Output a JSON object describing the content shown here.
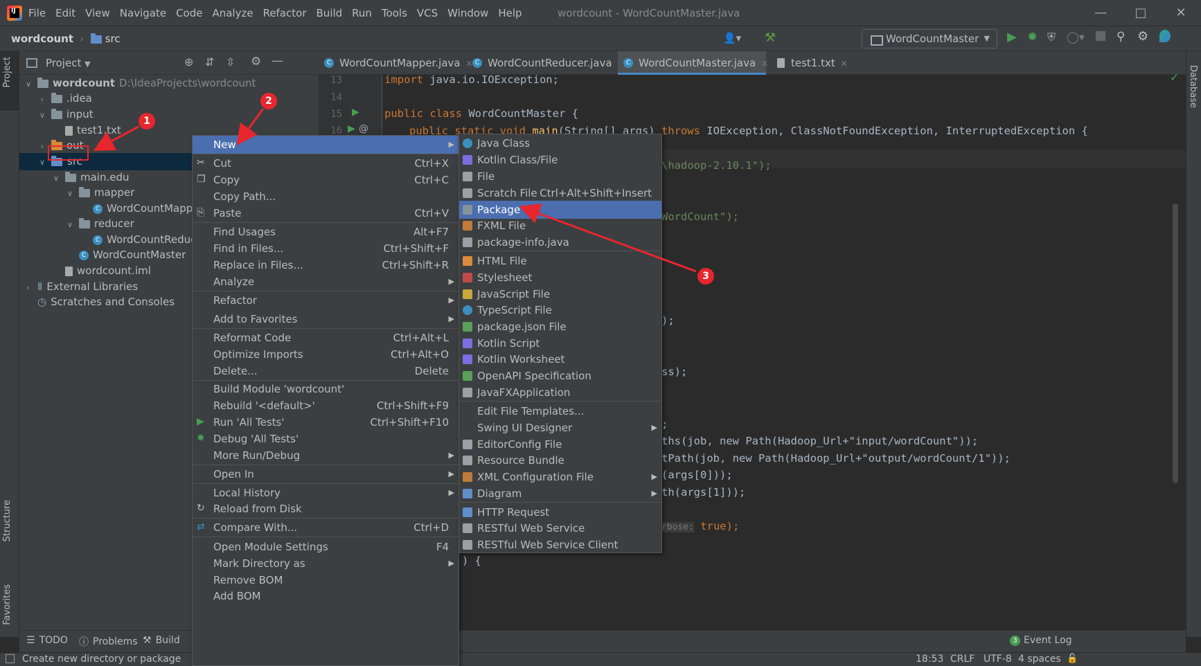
{
  "menubar": {
    "items": [
      "File",
      "Edit",
      "View",
      "Navigate",
      "Code",
      "Analyze",
      "Refactor",
      "Build",
      "Run",
      "Tools",
      "VCS",
      "Window",
      "Help"
    ],
    "title": "wordcount - WordCountMaster.java"
  },
  "navbar": {
    "project": "wordcount",
    "folder": "src",
    "run_config": "WordCountMaster"
  },
  "left_stripe": {
    "project_tab": "Project",
    "structure_tab": "Structure",
    "favorites_tab": "Favorites"
  },
  "right_stripe": {
    "database_tab": "Database"
  },
  "project_panel": {
    "title": "Project",
    "tree": [
      {
        "label": "wordcount",
        "extra": "D:\\IdeaProjects\\wordcount",
        "depth": 0,
        "open": true,
        "icon": "module-folder"
      },
      {
        "label": ".idea",
        "depth": 1,
        "open": false,
        "icon": "folder"
      },
      {
        "label": "input",
        "depth": 1,
        "open": true,
        "icon": "folder"
      },
      {
        "label": "test1.txt",
        "depth": 2,
        "icon": "text-file"
      },
      {
        "label": "out",
        "depth": 1,
        "open": false,
        "icon": "folder-orange"
      },
      {
        "label": "src",
        "depth": 1,
        "open": true,
        "icon": "folder-blue",
        "selected": true
      },
      {
        "label": "main.edu",
        "depth": 2,
        "open": true,
        "icon": "folder"
      },
      {
        "label": "mapper",
        "depth": 3,
        "open": true,
        "icon": "folder"
      },
      {
        "label": "WordCountMappe",
        "depth": 4,
        "icon": "class"
      },
      {
        "label": "reducer",
        "depth": 3,
        "open": true,
        "icon": "folder"
      },
      {
        "label": "WordCountReduc",
        "depth": 4,
        "icon": "class"
      },
      {
        "label": "WordCountMaster",
        "depth": 3,
        "icon": "class"
      },
      {
        "label": "wordcount.iml",
        "depth": 2,
        "icon": "iml-file"
      },
      {
        "label": "External Libraries",
        "depth": 0,
        "open": false,
        "icon": "libraries"
      },
      {
        "label": "Scratches and Consoles",
        "depth": 0,
        "icon": "scratches"
      }
    ]
  },
  "editor": {
    "tabs": [
      "WordCountMapper.java",
      "WordCountReducer.java",
      "WordCountMaster.java",
      "test1.txt"
    ],
    "active_tab": "WordCountMaster.java",
    "line_numbers": [
      "13",
      "14",
      "15",
      "16"
    ],
    "lines": {
      "l13_kw": "import",
      "l13_rest": " java.io.IOException;",
      "l15_kw": "public class",
      "l15_rest": " WordCountMaster {",
      "l16_kw1": "public static void",
      "l16_fn": "main",
      "l16_mid": "(String[] args) ",
      "l16_kw2": "throws",
      "l16_rest": " IOException, ClassNotFoundException, InterruptedException {"
    },
    "fragments": [
      {
        "text": "\\hadoop-2.10.1\");",
        "kind": "str"
      },
      {
        "text": "WordCount\");",
        "kind": "str"
      },
      {
        "text": ");",
        "kind": "plain"
      },
      {
        "text": "ss);",
        "kind": "plain"
      },
      {
        "text": ";",
        "kind": "plain"
      },
      {
        "text": "ths(job, new Path(Hadoop_Url+\"input/wordCount\"));",
        "kind": "plain"
      },
      {
        "text": "tPath(job, new Path(Hadoop_Url+\"output/wordCount/1\"));",
        "kind": "plain"
      },
      {
        "text": "(args[0]));",
        "kind": "plain"
      },
      {
        "text": "th(args[1]));",
        "kind": "plain"
      },
      {
        "text": "rbose:",
        "kind": "hint"
      },
      {
        "text": " true);",
        "kind": "kw"
      },
      {
        "text": ") {",
        "kind": "plain"
      }
    ]
  },
  "context_menu": {
    "items": [
      {
        "label": "New",
        "shortcut": "",
        "submenu": true,
        "highlight": true,
        "icon": ""
      },
      {
        "label": "Cut",
        "shortcut": "Ctrl+X",
        "icon": "scissors"
      },
      {
        "label": "Copy",
        "shortcut": "Ctrl+C",
        "icon": "copy"
      },
      {
        "label": "Copy Path...",
        "shortcut": ""
      },
      {
        "label": "Paste",
        "shortcut": "Ctrl+V",
        "icon": "paste"
      },
      {
        "label": "Find Usages",
        "shortcut": "Alt+F7"
      },
      {
        "label": "Find in Files...",
        "shortcut": "Ctrl+Shift+F"
      },
      {
        "label": "Replace in Files...",
        "shortcut": "Ctrl+Shift+R"
      },
      {
        "label": "Analyze",
        "submenu": true
      },
      {
        "label": "Refactor",
        "submenu": true
      },
      {
        "label": "Add to Favorites",
        "submenu": true
      },
      {
        "label": "Reformat Code",
        "shortcut": "Ctrl+Alt+L"
      },
      {
        "label": "Optimize Imports",
        "shortcut": "Ctrl+Alt+O"
      },
      {
        "label": "Delete...",
        "shortcut": "Delete"
      },
      {
        "label": "Build Module 'wordcount'",
        "shortcut": ""
      },
      {
        "label": "Rebuild '<default>'",
        "shortcut": "Ctrl+Shift+F9"
      },
      {
        "label": "Run 'All Tests'",
        "shortcut": "Ctrl+Shift+F10",
        "icon": "run"
      },
      {
        "label": "Debug 'All Tests'",
        "shortcut": "",
        "icon": "debug"
      },
      {
        "label": "More Run/Debug",
        "submenu": true
      },
      {
        "label": "Open In",
        "submenu": true
      },
      {
        "label": "Local History",
        "submenu": true
      },
      {
        "label": "Reload from Disk",
        "icon": "reload"
      },
      {
        "label": "Compare With...",
        "shortcut": "Ctrl+D",
        "icon": "compare"
      },
      {
        "label": "Open Module Settings",
        "shortcut": "F4"
      },
      {
        "label": "Mark Directory as",
        "submenu": true
      },
      {
        "label": "Remove BOM"
      },
      {
        "label": "Add BOM"
      }
    ]
  },
  "new_submenu": {
    "items": [
      {
        "label": "Java Class",
        "shortcut": "",
        "color": "#3a8fc0"
      },
      {
        "label": "Kotlin Class/File",
        "color": "#7f6ce0"
      },
      {
        "label": "File",
        "color": "#9aa0a6"
      },
      {
        "label": "Scratch File",
        "shortcut": "Ctrl+Alt+Shift+Insert",
        "color": "#9aa0a6"
      },
      {
        "label": "Package",
        "highlight": true,
        "color": "#87939a"
      },
      {
        "label": "FXML File",
        "color": "#c07a3a"
      },
      {
        "label": "package-info.java",
        "color": "#9aa0a6"
      },
      {
        "label": "HTML File",
        "color": "#d98a3a"
      },
      {
        "label": "Stylesheet",
        "color": "#c04a4a"
      },
      {
        "label": "JavaScript File",
        "color": "#c8a83a"
      },
      {
        "label": "TypeScript File",
        "color": "#3a8fc0"
      },
      {
        "label": "package.json File",
        "color": "#5aa05a"
      },
      {
        "label": "Kotlin Script",
        "color": "#7f6ce0"
      },
      {
        "label": "Kotlin Worksheet",
        "color": "#7f6ce0"
      },
      {
        "label": "OpenAPI Specification",
        "color": "#5aa05a"
      },
      {
        "label": "JavaFXApplication",
        "color": "#9aa0a6"
      },
      {
        "label": "Edit File Templates..."
      },
      {
        "label": "Swing UI Designer",
        "submenu": true
      },
      {
        "label": "EditorConfig File",
        "color": "#9aa0a6"
      },
      {
        "label": "Resource Bundle",
        "color": "#9aa0a6"
      },
      {
        "label": "XML Configuration File",
        "submenu": true,
        "color": "#c07a3a"
      },
      {
        "label": "Diagram",
        "submenu": true,
        "color": "#5f8ec9"
      },
      {
        "label": "HTTP Request",
        "color": "#5f8ec9"
      },
      {
        "label": "RESTful Web Service",
        "color": "#9aa0a6"
      },
      {
        "label": "RESTful Web Service Client",
        "color": "#9aa0a6"
      }
    ]
  },
  "bottom_tools": {
    "todo": "TODO",
    "problems": "Problems",
    "build": "Build",
    "event_log": "Event Log",
    "event_count": "3"
  },
  "statusbar": {
    "message": "Create new directory or package",
    "position": "18:53",
    "line_sep": "CRLF",
    "encoding": "UTF-8",
    "indent": "4 spaces"
  },
  "annotations": [
    "1",
    "2",
    "3"
  ],
  "colors": {
    "accent": "#4b6eaf",
    "selection": "#0d293e",
    "annotation_red": "#e8262e"
  }
}
